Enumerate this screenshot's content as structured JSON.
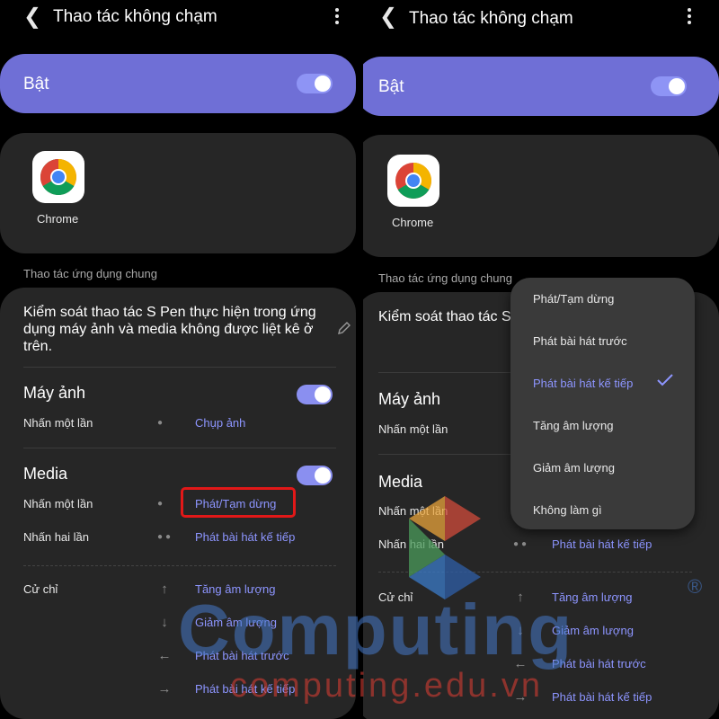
{
  "screen": {
    "title": "Thao tác không chạm",
    "enabled_label": "Bật",
    "enabled": true,
    "app_name": "Chrome",
    "section_label": "Thao tác ứng dụng chung",
    "description": "Kiểm soát thao tác S Pen thực hiện trong ứng dụng máy ảnh và media không được liệt kê ở trên.",
    "camera": {
      "title": "Máy ảnh",
      "enabled": true,
      "rows": [
        {
          "label": "Nhấn một lần",
          "value": "Chụp ảnh"
        }
      ]
    },
    "media": {
      "title": "Media",
      "enabled": true,
      "rows": [
        {
          "label": "Nhấn một lần",
          "value": "Phát/Tạm dừng"
        },
        {
          "label": "Nhấn hai lần",
          "value": "Phát bài hát kế tiếp"
        }
      ]
    },
    "gestures": {
      "label": "Cử chỉ",
      "items": [
        {
          "direction": "up",
          "value": "Tăng âm lượng"
        },
        {
          "direction": "down",
          "value": "Giảm âm lượng"
        },
        {
          "direction": "left",
          "value": "Phát bài hát trước"
        },
        {
          "direction": "right",
          "value": "Phát bài hát kế tiếp"
        }
      ]
    }
  },
  "dropdown": {
    "options": [
      "Phát/Tạm dừng",
      "Phát bài hát trước",
      "Phát bài hát kế tiếp",
      "Tăng âm lượng",
      "Giảm âm lượng",
      "Không làm gì"
    ],
    "selected": "Phát bài hát kế tiếp"
  },
  "watermark": {
    "text": "Computing",
    "sub": "computing.edu.vn",
    "registered": "®"
  },
  "colors": {
    "accent": "#8d95ff",
    "enabled_card": "#6f6fd6",
    "card": "#262626",
    "highlight": "#e11818"
  }
}
